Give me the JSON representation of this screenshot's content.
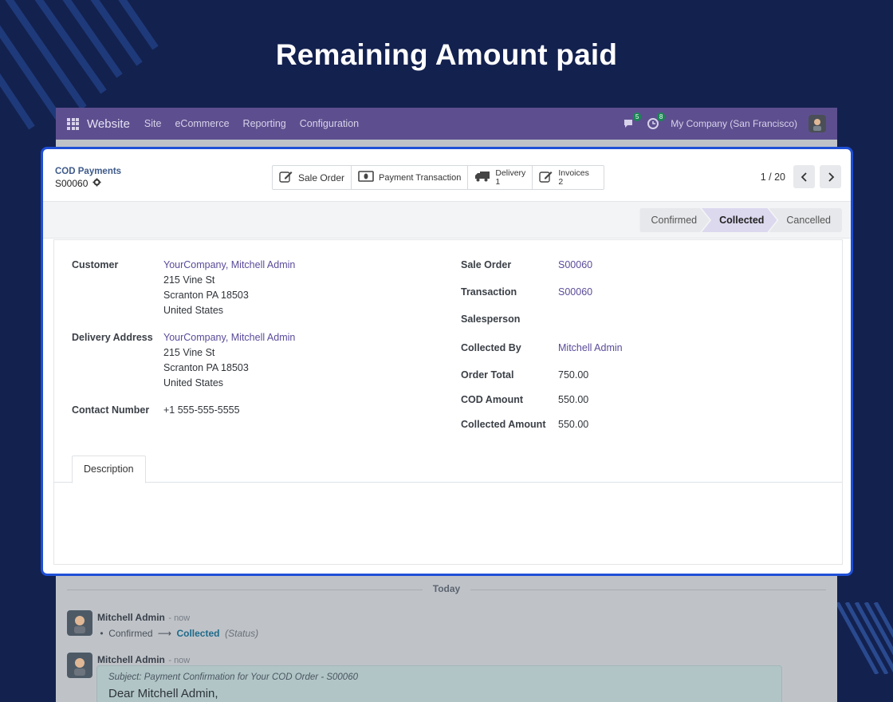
{
  "headline": "Remaining Amount paid",
  "navbar": {
    "app": "Website",
    "menus": [
      "Site",
      "eCommerce",
      "Reporting",
      "Configuration"
    ],
    "messages_badge": "5",
    "activity_badge": "8",
    "company": "My Company (San Francisco)"
  },
  "breadcrumb": {
    "parent": "COD Payments",
    "current": "S00060"
  },
  "smart_buttons": {
    "sale_order": "Sale Order",
    "payment_transaction": "Payment Transaction",
    "delivery_label": "Delivery",
    "delivery_count": "1",
    "invoices_label": "Invoices",
    "invoices_count": "2"
  },
  "pager": {
    "value": "1 / 20"
  },
  "status": {
    "stages": [
      "Confirmed",
      "Collected",
      "Cancelled"
    ],
    "active": "Collected"
  },
  "form": {
    "customer_label": "Customer",
    "customer_name": "YourCompany, Mitchell Admin",
    "customer_address": [
      "215 Vine St",
      "Scranton PA 18503",
      "United States"
    ],
    "delivery_label": "Delivery Address",
    "delivery_name": "YourCompany, Mitchell Admin",
    "delivery_address": [
      "215 Vine St",
      "Scranton PA 18503",
      "United States"
    ],
    "contact_label": "Contact Number",
    "contact_value": "+1 555-555-5555",
    "sale_order_label": "Sale Order",
    "sale_order_value": "S00060",
    "transaction_label": "Transaction",
    "transaction_value": "S00060",
    "salesperson_label": "Salesperson",
    "collected_by_label": "Collected By",
    "collected_by_value": "Mitchell Admin",
    "order_total_label": "Order Total",
    "order_total_value": "750.00",
    "cod_amount_label": "COD Amount",
    "cod_amount_value": "550.00",
    "collected_amount_label": "Collected Amount",
    "collected_amount_value": "550.00"
  },
  "tabs": {
    "description": "Description"
  },
  "chatter": {
    "today": "Today",
    "msg1_author": "Mitchell Admin",
    "msg1_time": "- now",
    "msg1_from": "Confirmed",
    "msg1_arrow": "⟶",
    "msg1_to": "Collected",
    "msg1_field": "(Status)",
    "msg2_author": "Mitchell Admin",
    "msg2_time": "- now",
    "mail_subject": "Subject: Payment Confirmation for Your COD Order - S00060",
    "mail_greeting": "Dear Mitchell Admin,"
  },
  "colors": {
    "background": "#13214f",
    "highlight_border": "#1f4fd6",
    "navbar": "#5d4f8f",
    "link": "#5b4b9a"
  }
}
